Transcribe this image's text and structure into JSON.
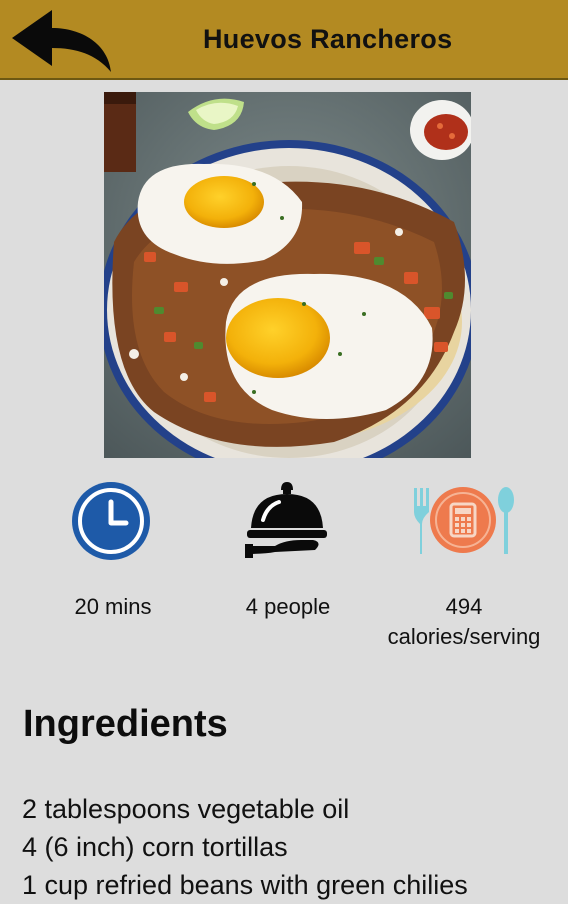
{
  "header": {
    "title": "Huevos Rancheros",
    "back_icon": "back-arrow-icon",
    "background": "#b38a22"
  },
  "hero": {
    "image": "huevos-rancheros-photo"
  },
  "stats": {
    "time": {
      "icon": "clock-icon",
      "label": "20 mins"
    },
    "servings": {
      "icon": "serving-cloche-icon",
      "label": "4 people"
    },
    "calories": {
      "icon": "calorie-calculator-icon",
      "value": "494",
      "unit": "calories/serving"
    }
  },
  "ingredients": {
    "title": "Ingredients",
    "items": [
      "2 tablespoons vegetable oil",
      "4 (6 inch) corn tortillas",
      "1 cup refried beans with green chilies"
    ]
  },
  "colors": {
    "clock": "#1e5aa8",
    "calorie_plate": "#ee7a4d",
    "utensils": "#7fd0dc"
  }
}
